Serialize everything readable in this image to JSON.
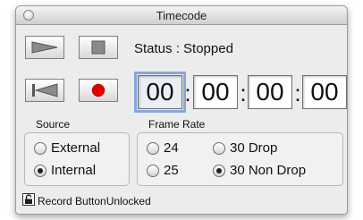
{
  "window": {
    "title": "Timecode"
  },
  "transport": {
    "play_icon": "play-icon",
    "stop_icon": "stop-icon",
    "rewind_icon": "rewind-to-start-icon",
    "record_icon": "record-icon",
    "record_color": "#e00000"
  },
  "status": {
    "text": "Status :  Stopped"
  },
  "timecode": {
    "hours": "00",
    "minutes": "00",
    "seconds": "00",
    "frames": "00",
    "separator": ":"
  },
  "source": {
    "title": "Source",
    "options": [
      {
        "label": "External",
        "selected": false
      },
      {
        "label": "Internal",
        "selected": true
      }
    ]
  },
  "frame_rate": {
    "title": "Frame Rate",
    "options": [
      {
        "label": "24",
        "selected": false
      },
      {
        "label": "25",
        "selected": false
      },
      {
        "label": "30 Drop",
        "selected": false
      },
      {
        "label": "30 Non Drop",
        "selected": true
      }
    ]
  },
  "lock": {
    "icon": "lock-icon",
    "label": "Record ButtonUnlocked"
  }
}
